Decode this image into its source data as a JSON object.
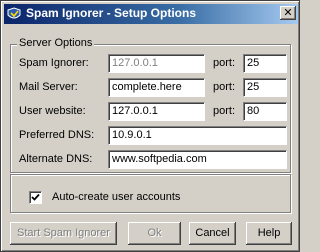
{
  "window": {
    "title": "Spam Ignorer - Setup Options",
    "close_label": "✕"
  },
  "server_options": {
    "group_title": "Server Options",
    "spam_ignorer": {
      "label": "Spam Ignorer:",
      "value": "127.0.0.1",
      "port_label": "port:",
      "port": "25"
    },
    "mail_server": {
      "label": "Mail Server:",
      "value": "complete.here",
      "port_label": "port:",
      "port": "25"
    },
    "user_website": {
      "label": "User website:",
      "value": "127.0.0.1",
      "port_label": "port:",
      "port": "80"
    },
    "preferred_dns": {
      "label": "Preferred DNS:",
      "value": "10.9.0.1"
    },
    "alternate_dns": {
      "label": "Alternate DNS:",
      "value": "www.softpedia.com"
    }
  },
  "auto_create": {
    "label": "Auto-create user accounts",
    "checked": true
  },
  "buttons": {
    "start": "Start Spam Ignorer",
    "ok": "Ok",
    "cancel": "Cancel",
    "help": "Help"
  },
  "colors": {
    "title_start": "#0a246a",
    "title_end": "#a6caf0",
    "face": "#d4d0c8"
  }
}
